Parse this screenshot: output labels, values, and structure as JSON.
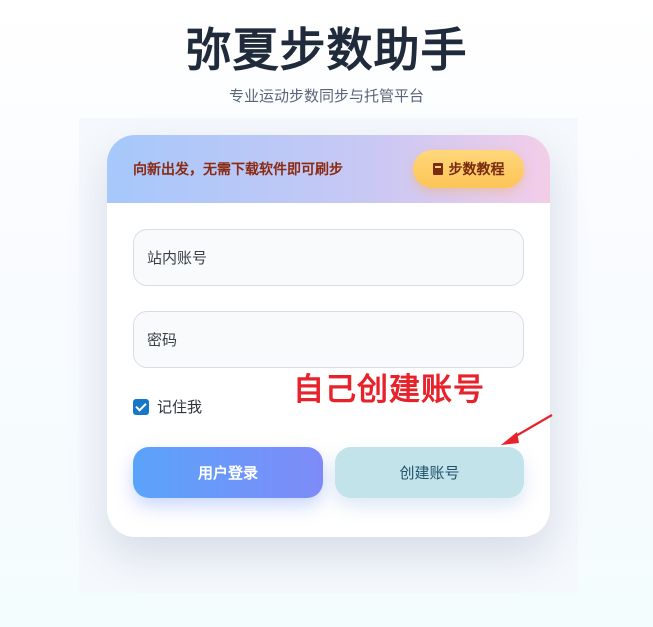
{
  "header": {
    "title": "弥夏步数助手",
    "subtitle": "专业运动步数同步与托管平台"
  },
  "card": {
    "banner_text": "向新出发，无需下载软件即可刷步",
    "tutorial_label": "步数教程",
    "tutorial_icon": "book-icon",
    "account_placeholder": "站内账号",
    "password_placeholder": "密码",
    "remember_label": "记住我",
    "remember_checked": true,
    "login_label": "用户登录",
    "create_label": "创建账号"
  },
  "annotation": {
    "text": "自己创建账号",
    "color": "#e8222a"
  },
  "colors": {
    "title": "#1f2a3a",
    "accent": "#1677c8",
    "login_gradient_start": "#5aa3fb",
    "login_gradient_end": "#7e8bf8",
    "tutorial_bg": "#fdc457"
  }
}
